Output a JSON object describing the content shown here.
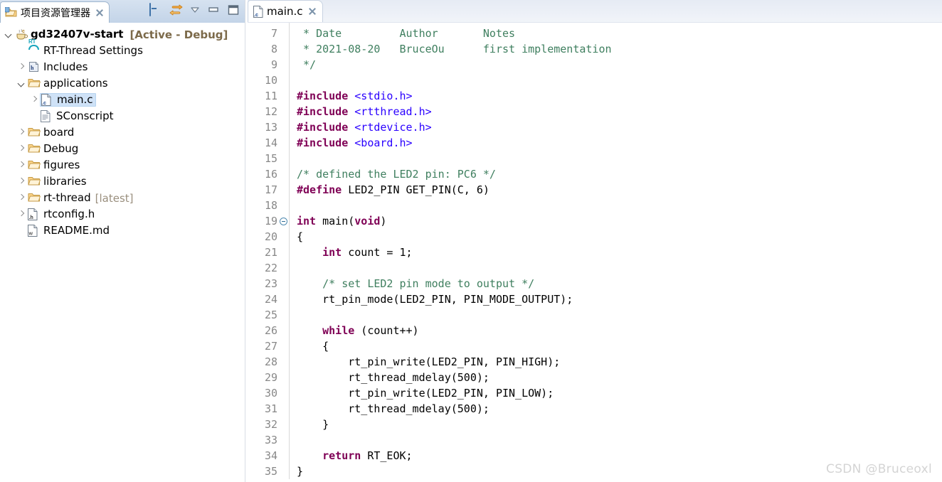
{
  "explorer": {
    "tab_label": "项目资源管理器",
    "tab_icon": "project-explorer-icon",
    "close_icon": "close-icon",
    "toolbar": [
      {
        "name": "collapse-all-icon",
        "title": "Collapse All"
      },
      {
        "name": "link-with-editor-icon",
        "title": "Link with Editor"
      },
      {
        "name": "view-menu-icon",
        "title": "View Menu"
      },
      {
        "name": "minimize-icon",
        "title": "Minimize"
      },
      {
        "name": "maximize-icon",
        "title": "Maximize"
      }
    ],
    "tree": [
      {
        "indent": 0,
        "twisty": "expanded",
        "icon": "c-project-icon",
        "label": "gd32407v-start",
        "bold": true,
        "suffix": "[Active - Debug]",
        "suffix_style": "bold",
        "selected": false
      },
      {
        "indent": 1,
        "twisty": "none",
        "icon": "rt-thread-icon",
        "label": "RT-Thread Settings",
        "bold": false,
        "suffix": "",
        "suffix_style": "",
        "selected": false
      },
      {
        "indent": 1,
        "twisty": "collapsed",
        "icon": "includes-icon",
        "label": "Includes",
        "bold": false,
        "suffix": "",
        "suffix_style": "",
        "selected": false
      },
      {
        "indent": 1,
        "twisty": "expanded",
        "icon": "folder-icon",
        "label": "applications",
        "bold": false,
        "suffix": "",
        "suffix_style": "",
        "selected": false
      },
      {
        "indent": 2,
        "twisty": "collapsed",
        "icon": "c-file-icon",
        "label": "main.c",
        "bold": false,
        "suffix": "",
        "suffix_style": "",
        "selected": true
      },
      {
        "indent": 2,
        "twisty": "none",
        "icon": "script-file-icon",
        "label": "SConscript",
        "bold": false,
        "suffix": "",
        "suffix_style": "",
        "selected": false
      },
      {
        "indent": 1,
        "twisty": "collapsed",
        "icon": "folder-icon",
        "label": "board",
        "bold": false,
        "suffix": "",
        "suffix_style": "",
        "selected": false
      },
      {
        "indent": 1,
        "twisty": "collapsed",
        "icon": "folder-icon",
        "label": "Debug",
        "bold": false,
        "suffix": "",
        "suffix_style": "",
        "selected": false
      },
      {
        "indent": 1,
        "twisty": "collapsed",
        "icon": "folder-icon",
        "label": "figures",
        "bold": false,
        "suffix": "",
        "suffix_style": "",
        "selected": false
      },
      {
        "indent": 1,
        "twisty": "collapsed",
        "icon": "folder-icon",
        "label": "libraries",
        "bold": false,
        "suffix": "",
        "suffix_style": "",
        "selected": false
      },
      {
        "indent": 1,
        "twisty": "collapsed",
        "icon": "folder-icon",
        "label": "rt-thread",
        "bold": false,
        "suffix": "[latest]",
        "suffix_style": "plain",
        "selected": false
      },
      {
        "indent": 1,
        "twisty": "collapsed",
        "icon": "h-file-icon",
        "label": "rtconfig.h",
        "bold": false,
        "suffix": "",
        "suffix_style": "",
        "selected": false
      },
      {
        "indent": 1,
        "twisty": "none",
        "icon": "md-file-icon",
        "label": "README.md",
        "bold": false,
        "suffix": "",
        "suffix_style": "",
        "selected": false
      }
    ]
  },
  "editor": {
    "tab_label": "main.c",
    "tab_icon": "c-file-icon",
    "close_icon": "close-icon",
    "first_line_number": 7,
    "lines": [
      {
        "n": 7,
        "fold": false,
        "tokens": [
          {
            "t": " * Date         Author       Notes",
            "c": "cm"
          }
        ]
      },
      {
        "n": 8,
        "fold": false,
        "tokens": [
          {
            "t": " * 2021-08-20   BruceOu      first implementation",
            "c": "cm"
          }
        ]
      },
      {
        "n": 9,
        "fold": false,
        "tokens": [
          {
            "t": " */",
            "c": "cm"
          }
        ]
      },
      {
        "n": 10,
        "fold": false,
        "tokens": [
          {
            "t": "",
            "c": "pl"
          }
        ]
      },
      {
        "n": 11,
        "fold": false,
        "tokens": [
          {
            "t": "#include ",
            "c": "pp"
          },
          {
            "t": "<stdio.h>",
            "c": "inc"
          }
        ]
      },
      {
        "n": 12,
        "fold": false,
        "tokens": [
          {
            "t": "#include ",
            "c": "pp"
          },
          {
            "t": "<rtthread.h>",
            "c": "inc"
          }
        ]
      },
      {
        "n": 13,
        "fold": false,
        "tokens": [
          {
            "t": "#include ",
            "c": "pp"
          },
          {
            "t": "<rtdevice.h>",
            "c": "inc"
          }
        ]
      },
      {
        "n": 14,
        "fold": false,
        "tokens": [
          {
            "t": "#include ",
            "c": "pp"
          },
          {
            "t": "<board.h>",
            "c": "inc"
          }
        ]
      },
      {
        "n": 15,
        "fold": false,
        "tokens": [
          {
            "t": "",
            "c": "pl"
          }
        ]
      },
      {
        "n": 16,
        "fold": false,
        "tokens": [
          {
            "t": "/* defined the LED2 pin: PC6 */",
            "c": "cm"
          }
        ]
      },
      {
        "n": 17,
        "fold": false,
        "tokens": [
          {
            "t": "#define",
            "c": "pp"
          },
          {
            "t": " LED2_PIN GET_PIN(C, 6)",
            "c": "pl"
          }
        ]
      },
      {
        "n": 18,
        "fold": false,
        "tokens": [
          {
            "t": "",
            "c": "pl"
          }
        ]
      },
      {
        "n": 19,
        "fold": true,
        "tokens": [
          {
            "t": "int ",
            "c": "kw"
          },
          {
            "t": "main(",
            "c": "pl"
          },
          {
            "t": "void",
            "c": "kw"
          },
          {
            "t": ")",
            "c": "pl"
          }
        ]
      },
      {
        "n": 20,
        "fold": false,
        "tokens": [
          {
            "t": "{",
            "c": "pl"
          }
        ]
      },
      {
        "n": 21,
        "fold": false,
        "tokens": [
          {
            "t": "    ",
            "c": "pl"
          },
          {
            "t": "int",
            "c": "kw"
          },
          {
            "t": " count = 1;",
            "c": "pl"
          }
        ]
      },
      {
        "n": 22,
        "fold": false,
        "tokens": [
          {
            "t": "",
            "c": "pl"
          }
        ]
      },
      {
        "n": 23,
        "fold": false,
        "tokens": [
          {
            "t": "    /* set LED2 pin mode to output */",
            "c": "cm"
          }
        ]
      },
      {
        "n": 24,
        "fold": false,
        "tokens": [
          {
            "t": "    rt_pin_mode(LED2_PIN, PIN_MODE_OUTPUT);",
            "c": "pl"
          }
        ]
      },
      {
        "n": 25,
        "fold": false,
        "tokens": [
          {
            "t": "",
            "c": "pl"
          }
        ]
      },
      {
        "n": 26,
        "fold": false,
        "tokens": [
          {
            "t": "    ",
            "c": "pl"
          },
          {
            "t": "while",
            "c": "kw"
          },
          {
            "t": " (count++)",
            "c": "pl"
          }
        ]
      },
      {
        "n": 27,
        "fold": false,
        "tokens": [
          {
            "t": "    {",
            "c": "pl"
          }
        ]
      },
      {
        "n": 28,
        "fold": false,
        "tokens": [
          {
            "t": "        rt_pin_write(LED2_PIN, PIN_HIGH);",
            "c": "pl"
          }
        ]
      },
      {
        "n": 29,
        "fold": false,
        "tokens": [
          {
            "t": "        rt_thread_mdelay(500);",
            "c": "pl"
          }
        ]
      },
      {
        "n": 30,
        "fold": false,
        "tokens": [
          {
            "t": "        rt_pin_write(LED2_PIN, PIN_LOW);",
            "c": "pl"
          }
        ]
      },
      {
        "n": 31,
        "fold": false,
        "tokens": [
          {
            "t": "        rt_thread_mdelay(500);",
            "c": "pl"
          }
        ]
      },
      {
        "n": 32,
        "fold": false,
        "tokens": [
          {
            "t": "    }",
            "c": "pl"
          }
        ]
      },
      {
        "n": 33,
        "fold": false,
        "tokens": [
          {
            "t": "",
            "c": "pl"
          }
        ]
      },
      {
        "n": 34,
        "fold": false,
        "tokens": [
          {
            "t": "    ",
            "c": "pl"
          },
          {
            "t": "return",
            "c": "kw"
          },
          {
            "t": " RT_EOK;",
            "c": "pl"
          }
        ]
      },
      {
        "n": 35,
        "fold": false,
        "tokens": [
          {
            "t": "}",
            "c": "pl"
          }
        ]
      }
    ]
  },
  "watermark": {
    "text": "CSDN @Bruceoxl"
  },
  "colors": {
    "comment": "#3f7f5f",
    "preprocessor": "#7f0055",
    "include_path": "#2a00ff",
    "keyword": "#7f0055",
    "selection": "#cfe2f7",
    "tabstrip": "#c9d9ec",
    "folder": "#fcd48a"
  }
}
